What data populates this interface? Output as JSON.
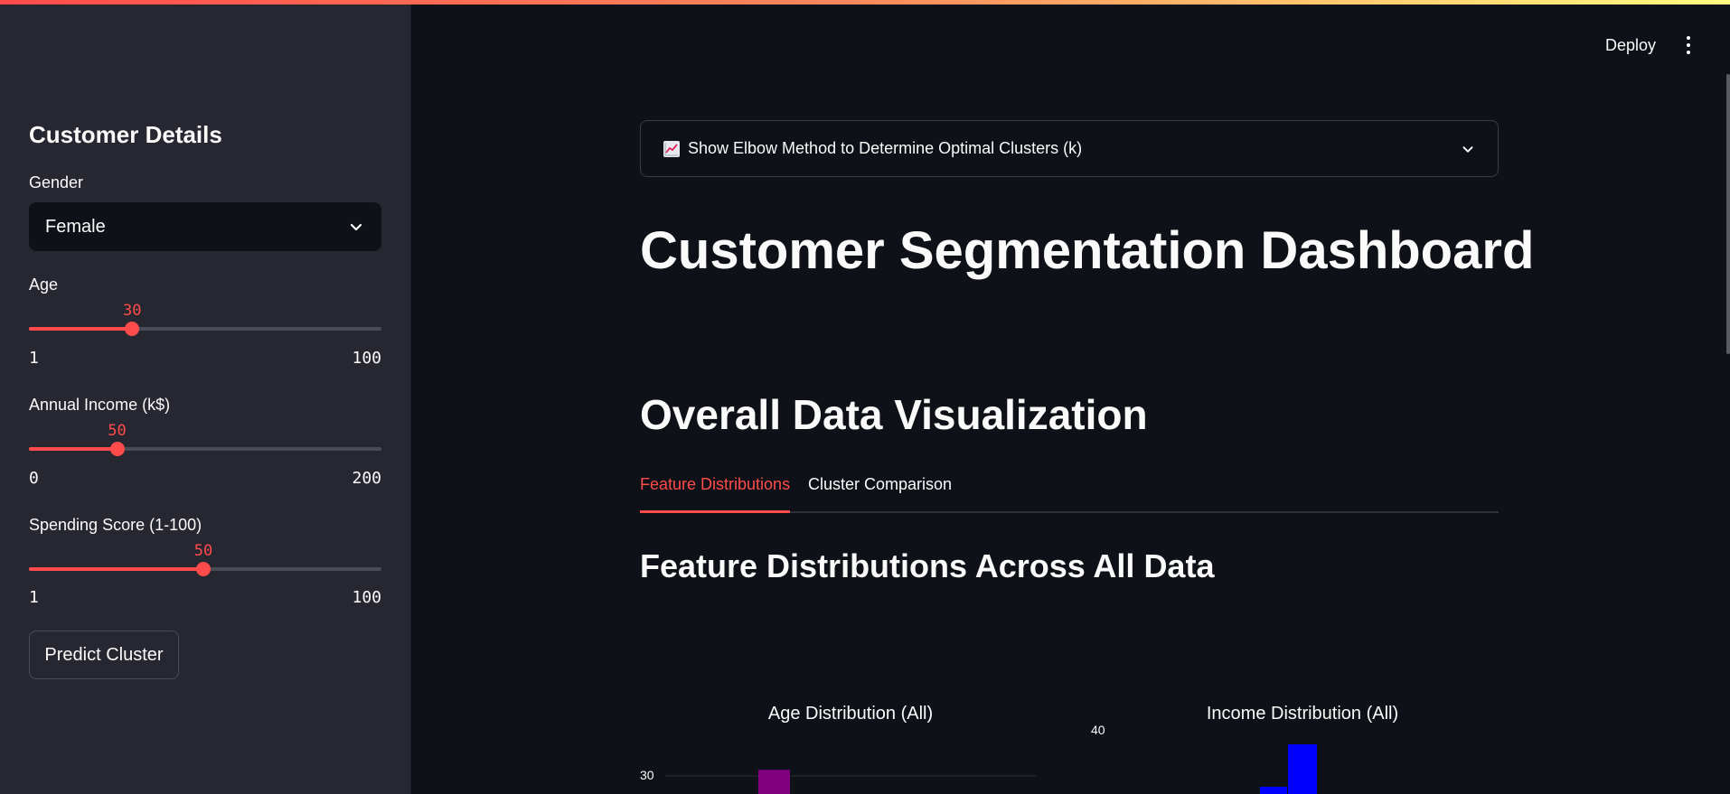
{
  "sidebar": {
    "title": "Customer Details",
    "gender": {
      "label": "Gender",
      "value": "Female"
    },
    "age": {
      "label": "Age",
      "value": "30",
      "min": "1",
      "max": "100",
      "fraction": 0.293
    },
    "income": {
      "label": "Annual Income (k$)",
      "value": "50",
      "min": "0",
      "max": "200",
      "fraction": 0.25
    },
    "spending": {
      "label": "Spending Score (1-100)",
      "value": "50",
      "min": "1",
      "max": "100",
      "fraction": 0.495
    },
    "predict_button": "Predict Cluster"
  },
  "header": {
    "deploy_label": "Deploy",
    "menu_icon": "kebab-menu-icon"
  },
  "main": {
    "expander": {
      "icon": "chart-increasing-icon",
      "label": "Show Elbow Method to Determine Optimal Clusters (k)"
    },
    "title": "Customer Segmentation Dashboard",
    "section_title": "Overall Data Visualization",
    "tabs": [
      {
        "label": "Feature Distributions",
        "active": true
      },
      {
        "label": "Cluster Comparison",
        "active": false
      }
    ],
    "subsection_title": "Feature Distributions Across All Data"
  },
  "chart_data": [
    {
      "type": "bar",
      "title": "Age Distribution (All)",
      "y_ticks": [
        "30"
      ],
      "color": "#800080",
      "series": [
        {
          "values": [
            32
          ]
        }
      ]
    },
    {
      "type": "bar",
      "title": "Income Distribution (All)",
      "y_ticks": [
        "40"
      ],
      "color": "#0000ff",
      "series": [
        {
          "values": [
            4,
            40
          ]
        }
      ]
    }
  ],
  "colors": {
    "accent": "#ff4b4b",
    "sidebar_bg": "#262730",
    "main_bg": "#0e1117"
  }
}
